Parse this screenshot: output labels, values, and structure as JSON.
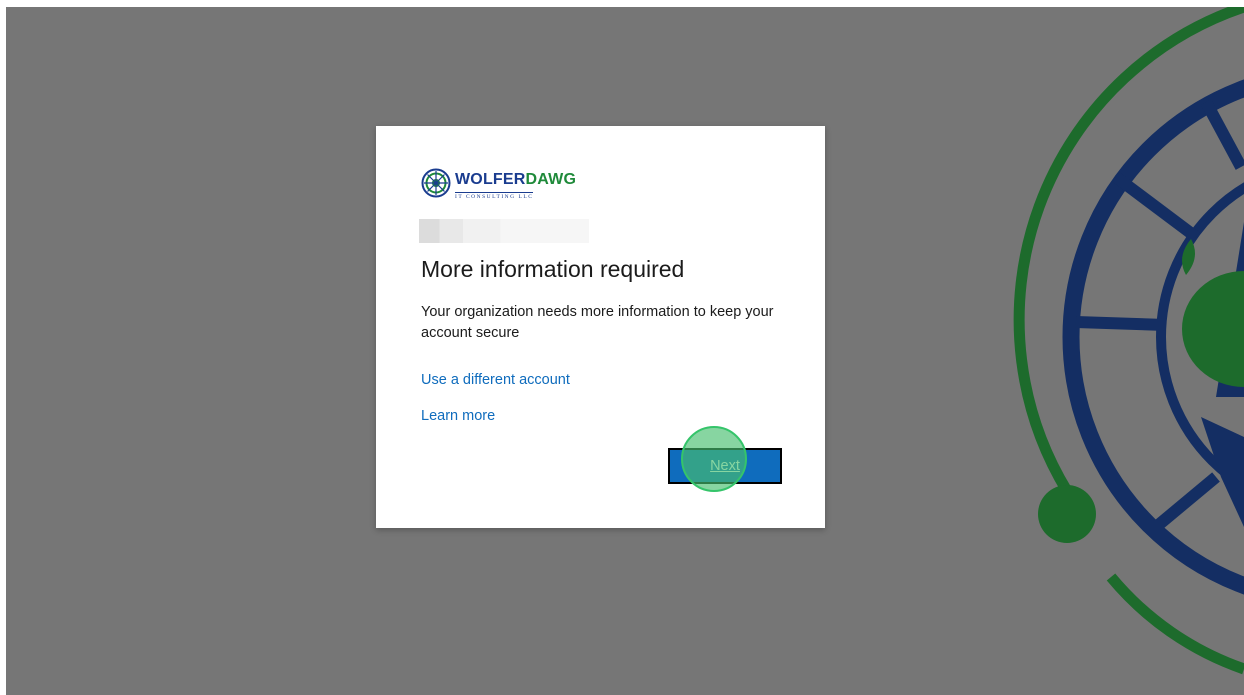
{
  "brand": {
    "name_part1": "WOLFER",
    "name_part2": "DAWG",
    "tagline": "IT CONSULTING LLC",
    "logo_icon": "wolferdawg-logo-icon"
  },
  "dialog": {
    "title": "More information required",
    "description": "Your organization needs more information to keep your account secure",
    "links": {
      "different_account": "Use a different account",
      "learn_more": "Learn more"
    },
    "next_label": "Next"
  },
  "colors": {
    "backdrop": "#767676",
    "card": "#ffffff",
    "primary": "#0f6cbd",
    "link": "#0f6cbd",
    "brand_blue": "#1a3c8f",
    "brand_green": "#1f8a3a",
    "click_highlight": "#35c46a"
  }
}
